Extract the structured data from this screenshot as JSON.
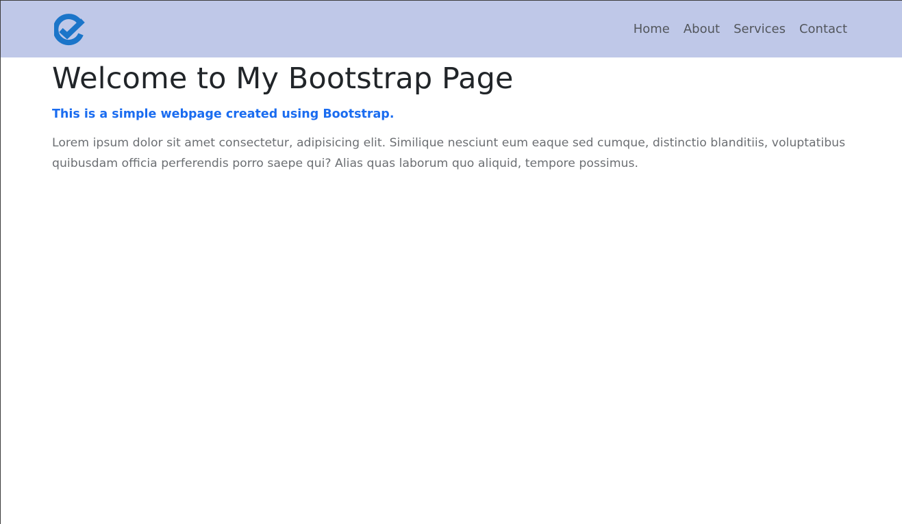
{
  "navbar": {
    "logo_icon": "check-circle-e-logo",
    "brand_color": "#1b75c9",
    "background": "#bfc8e8",
    "links": [
      {
        "label": "Home"
      },
      {
        "label": "About"
      },
      {
        "label": "Services"
      },
      {
        "label": "Contact"
      }
    ]
  },
  "main": {
    "title": "Welcome to My Bootstrap Page",
    "subtitle": "This is a simple webpage created using Bootstrap.",
    "subtitle_color": "#1a6cf0",
    "paragraph": "Lorem ipsum dolor sit amet consectetur, adipisicing elit. Similique nesciunt eum eaque sed cumque, distinctio blanditiis, voluptatibus quibusdam officia perferendis porro saepe qui? Alias quas laborum quo aliquid, tempore possimus."
  }
}
